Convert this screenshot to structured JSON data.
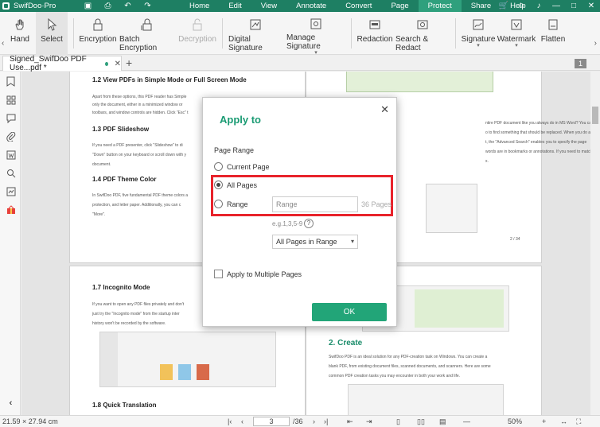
{
  "app": {
    "name": "SwifDoo·Pro"
  },
  "menubar": {
    "items": [
      "Home",
      "Edit",
      "View",
      "Annotate",
      "Convert",
      "Page",
      "Protect",
      "Share",
      "Help"
    ],
    "active": "Protect"
  },
  "toolbar": {
    "tools": [
      {
        "label": "Hand",
        "icon": "hand-icon",
        "state": "normal"
      },
      {
        "label": "Select",
        "icon": "select-arrow-icon",
        "state": "selected"
      },
      {
        "label": "Encryption",
        "icon": "lock-icon",
        "state": "normal"
      },
      {
        "label": "Batch Encryption",
        "icon": "lock-batch-icon",
        "state": "normal"
      },
      {
        "label": "Decryption",
        "icon": "unlock-icon",
        "state": "disabled"
      },
      {
        "label": "Digital Signature",
        "icon": "digital-signature-icon",
        "state": "normal"
      },
      {
        "label": "Manage Signature",
        "icon": "manage-signature-icon",
        "state": "normal"
      },
      {
        "label": "Redaction",
        "icon": "redaction-icon",
        "state": "normal"
      },
      {
        "label": "Search & Redact",
        "icon": "search-redact-icon",
        "state": "normal"
      },
      {
        "label": "Signature",
        "icon": "signature-icon",
        "state": "normal"
      },
      {
        "label": "Watermark",
        "icon": "watermark-icon",
        "state": "normal"
      },
      {
        "label": "Flatten",
        "icon": "flatten-icon",
        "state": "normal"
      }
    ]
  },
  "tabs": {
    "document_tab": "Signed_SwifDoo PDF Use...pdf *",
    "page_badge": "1"
  },
  "document": {
    "left_page_top": {
      "h1": "1.2 View PDFs in Simple Mode or Full Screen Mode",
      "p1": "Apart from these options, this PDF reader has Simple",
      "p2": "only the document, either in a minimized window or",
      "p3": "toolbars, and window controls are hidden. Click \"Esc\" t",
      "h2": "1.3 PDF Slideshow",
      "p4": "If you need a PDF presenter, click \"Slideshow\" to di",
      "p5": "\"Down\" button on your keyboard or scroll down with y",
      "p6": "document.",
      "h3": "1.4 PDF Theme Color",
      "p7": "In SwifDoo PDF, five fundamental PDF theme colors a",
      "p8": "protection, and letter paper. Additionally, you can c",
      "p9": "\"More\"."
    },
    "right_page_top": {
      "p1": "ntire PDF document like you always do in MS Word? You can",
      "p2": "o to find something that should be replaced. When you do a",
      "p3": "t, the \"Advanced Search\" enables you to specify the page",
      "p4": "words are in bookmarks or annotations. If you need to match",
      "p5": "x.",
      "page_num": "2 / 34"
    },
    "left_page_bottom": {
      "h1": "1.7 Incognito Mode",
      "p1": "If you want to open any PDF files privately and don't",
      "p2": "just try the \"Incognito mode\" from the startup inter",
      "p3": "history won't be recorded by the software.",
      "h2": "1.8 Quick Translation"
    },
    "right_page_bottom": {
      "h1": "2. Create",
      "p1": "SwifDoo PDF is an ideal solution for any PDF-creation task on Windows. You can create a",
      "p2": "blank PDF, from existing document files, scanned documents, and scanners. Here are some",
      "p3": "common PDF creation tasks you may encounter in both your work and life."
    }
  },
  "dialog": {
    "title": "Apply to",
    "section_label": "Page Range",
    "options": {
      "current_page": "Current Page",
      "all_pages": "All Pages",
      "range": "Range"
    },
    "selected_option": "all_pages",
    "range_placeholder": "Range",
    "page_count": "36 Pages",
    "example": "e.g.1,3,5-9",
    "help_symbol": "?",
    "subset_select": "All Pages in Range",
    "multiple_pages_label": "Apply to Multiple Pages",
    "ok_label": "OK"
  },
  "statusbar": {
    "page_size": "21.59 × 27.94 cm",
    "current_page": "3",
    "total_pages": "/36",
    "zoom": "50%"
  },
  "colors": {
    "brand_green": "#1e7f63",
    "accent_green": "#22a578",
    "highlight_red": "#e8232b"
  }
}
